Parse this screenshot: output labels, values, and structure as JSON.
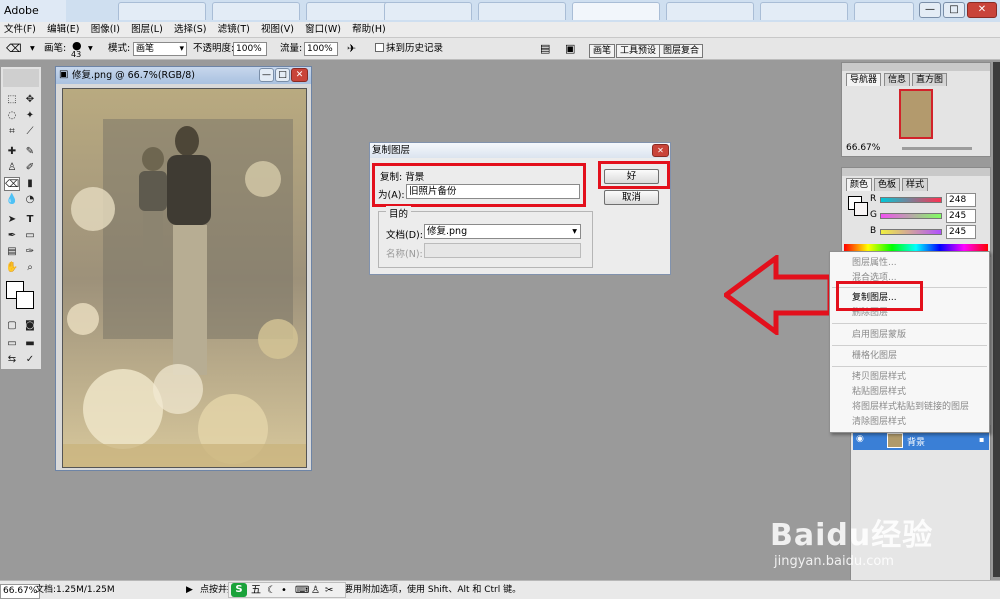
{
  "app": {
    "title": "Adobe Photoshop",
    "window_buttons": [
      "—",
      "□",
      "✕"
    ]
  },
  "menubar": [
    "文件(F)",
    "编辑(E)",
    "图像(I)",
    "图层(L)",
    "选择(S)",
    "滤镜(T)",
    "视图(V)",
    "窗口(W)",
    "帮助(H)"
  ],
  "options": {
    "brush_label": "画笔:",
    "brush_size": "43",
    "mode_label": "模式:",
    "mode_value": "画笔",
    "opacity_label": "不透明度:",
    "opacity_value": "100%",
    "flow_label": "流量:",
    "flow_value": "100%",
    "erase_history_label": "抹到历史记录",
    "palette_tabs": [
      "画笔",
      "工具预设",
      "图层复合"
    ]
  },
  "document": {
    "title": "修复.png @ 66.7%(RGB/8)"
  },
  "status": {
    "zoom": "66.67%",
    "doc_size": "文档:1.25M/1.25M",
    "hint": "点按并拖移以抹除至历史记录状态。要用附加选项，使用 Shift、Alt 和 Ctrl 键。"
  },
  "navigator": {
    "tabs": [
      "导航器",
      "信息",
      "直方图"
    ],
    "zoom": "66.67%"
  },
  "color_palette": {
    "tabs": [
      "颜色",
      "色板",
      "样式"
    ],
    "channels": [
      {
        "label": "R",
        "value": "248",
        "fraction": 0.97
      },
      {
        "label": "G",
        "value": "245",
        "fraction": 0.96
      },
      {
        "label": "B",
        "value": "245",
        "fraction": 0.96
      }
    ]
  },
  "layers": {
    "background_name": "背景"
  },
  "dialog": {
    "title": "复制图层",
    "copy_label": "复制: 背景",
    "as_label": "为(A):",
    "as_value": "旧照片备份",
    "ok_label": "好",
    "cancel_label": "取消",
    "dest_group_label": "目的",
    "doc_label": "文档(D):",
    "doc_value": "修复.png",
    "name_label": "名称(N):",
    "name_value": ""
  },
  "context_menu": {
    "items": [
      {
        "label": "图层属性...",
        "enabled": false
      },
      {
        "label": "混合选项...",
        "enabled": false
      },
      {
        "label": "复制图层...",
        "enabled": true
      },
      {
        "label": "删除图层",
        "enabled": false
      },
      {
        "label": "启用图层蒙版",
        "enabled": false
      },
      {
        "label": "栅格化图层",
        "enabled": false
      },
      {
        "label": "拷贝图层样式",
        "enabled": false
      },
      {
        "label": "粘贴图层样式",
        "enabled": false
      },
      {
        "label": "将图层样式粘贴到链接的图层",
        "enabled": false
      },
      {
        "label": "清除图层样式",
        "enabled": false
      }
    ]
  },
  "taskbar": {
    "ime_label": "五"
  },
  "watermark": {
    "brand": "Baidu经验",
    "url": "jingyan.baidu.com"
  },
  "colors": {
    "highlight_red": "#e3101c",
    "layer_selected": "#3a7fd6"
  }
}
